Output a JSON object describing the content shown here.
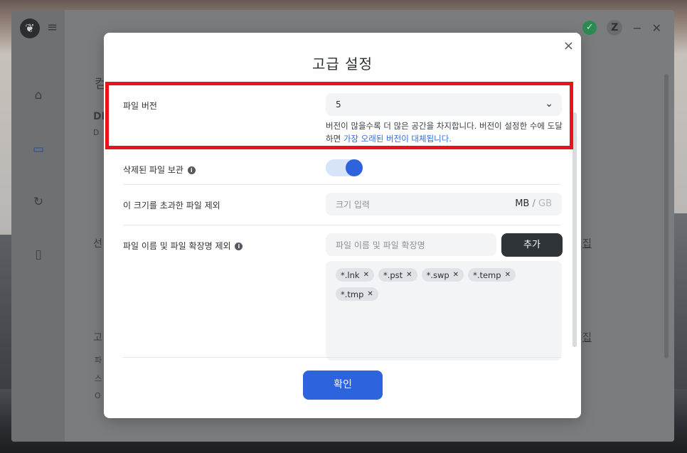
{
  "background_app": {
    "logo": "leaf-logo-icon",
    "side_text": [
      "컴",
      "DI",
      "D",
      "선",
      "고",
      "파",
      "스",
      "O"
    ],
    "right_text": [
      "집",
      "집"
    ]
  },
  "modal": {
    "title": "고급 설정",
    "close": "×",
    "file_version": {
      "label": "파일 버전",
      "value": "5",
      "hint_prefix": "버전이 많을수록 더 많은 공간을 차지합니다. 버전이 설정한 수에 도달하면 ",
      "hint_link": "가장 오래된 버전이 대체됩니다."
    },
    "keep_deleted": {
      "label": "삭제된 파일 보관",
      "enabled": true
    },
    "exclude_size": {
      "label": "이 크기를 초과한 파일 제외",
      "placeholder": "크기 입력",
      "unit_selected": "MB",
      "unit_separator": "/",
      "unit_other": "GB"
    },
    "exclude_names": {
      "label": "파일 이름 및 파일 확장명 제외",
      "placeholder": "파일 이름 및 파일 확장명",
      "add_label": "추가",
      "tags": [
        "*.lnk",
        "*.pst",
        "*.swp",
        "*.temp",
        "*.tmp"
      ]
    },
    "confirm_label": "확인"
  },
  "colors": {
    "accent": "#2d63dc",
    "highlight": "#e8141a",
    "dark_button": "#2f3439"
  }
}
